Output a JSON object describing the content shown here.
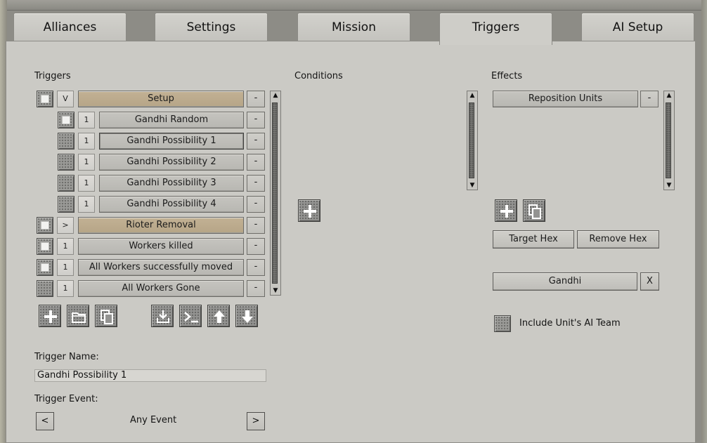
{
  "tabs": [
    {
      "label": "Alliances",
      "active": false
    },
    {
      "label": "Settings",
      "active": false
    },
    {
      "label": "Mission",
      "active": false
    },
    {
      "label": "Triggers",
      "active": true
    },
    {
      "label": "AI Setup",
      "active": false
    }
  ],
  "triggers": {
    "heading": "Triggers",
    "rows": [
      {
        "mini": "V",
        "label": "Setup",
        "minus": "-",
        "group": true,
        "checked": true,
        "indent": false
      },
      {
        "mini": "1",
        "label": "Gandhi Random",
        "minus": "-",
        "group": false,
        "checked": true,
        "indent": true
      },
      {
        "mini": "1",
        "label": "Gandhi Possibility 1",
        "minus": "-",
        "group": false,
        "checked": false,
        "indent": true,
        "selected": true
      },
      {
        "mini": "1",
        "label": "Gandhi Possibility 2",
        "minus": "-",
        "group": false,
        "checked": false,
        "indent": true
      },
      {
        "mini": "1",
        "label": "Gandhi Possibility 3",
        "minus": "-",
        "group": false,
        "checked": false,
        "indent": true
      },
      {
        "mini": "1",
        "label": "Gandhi Possibility 4",
        "minus": "-",
        "group": false,
        "checked": false,
        "indent": true
      },
      {
        "mini": ">",
        "label": "Rioter Removal",
        "minus": "-",
        "group": true,
        "checked": true,
        "indent": false
      },
      {
        "mini": "1",
        "label": "Workers killed",
        "minus": "-",
        "group": false,
        "checked": true,
        "indent": false
      },
      {
        "mini": "1",
        "label": "All Workers successfully moved",
        "minus": "-",
        "group": false,
        "checked": true,
        "indent": false
      },
      {
        "mini": "1",
        "label": "All Workers Gone",
        "minus": "-",
        "group": false,
        "checked": false,
        "indent": false
      }
    ],
    "toolbar_icons": [
      "plus-icon",
      "folder-icon",
      "copy-icon",
      "import-icon",
      "console-icon",
      "arrow-up-icon",
      "arrow-down-icon"
    ],
    "name_label": "Trigger Name:",
    "name_value": "Gandhi Possibility 1",
    "event_label": "Trigger Event:",
    "event_prev": "<",
    "event_value": "Any Event",
    "event_next": ">"
  },
  "conditions": {
    "heading": "Conditions",
    "add_icon": "plus-icon"
  },
  "effects": {
    "heading": "Effects",
    "items": [
      {
        "label": "Reposition Units",
        "minus": "-"
      }
    ],
    "icons": [
      "plus-icon",
      "copy-icon"
    ],
    "target_hex": "Target Hex",
    "remove_hex": "Remove Hex",
    "unit_name": "Gandhi",
    "unit_clear": "X",
    "include_ai_team": "Include Unit's AI Team",
    "include_ai_team_checked": false
  }
}
